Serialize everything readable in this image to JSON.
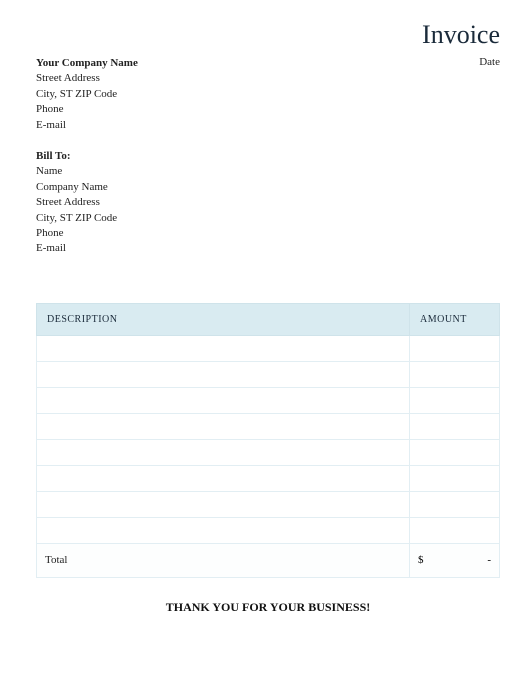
{
  "title": "Invoice",
  "date_label": "Date",
  "company": {
    "name": "Your Company Name",
    "street": "Street Address",
    "city_line": "City, ST  ZIP Code",
    "phone": "Phone",
    "email": "E-mail"
  },
  "bill_to": {
    "label": "Bill To:",
    "name": "Name",
    "company": "Company Name",
    "street": "Street Address",
    "city_line": "City, ST  ZIP Code",
    "phone": "Phone",
    "email": "E-mail"
  },
  "table": {
    "headers": {
      "description": "DESCRIPTION",
      "amount": "AMOUNT"
    },
    "rows": [
      {
        "description": "",
        "amount": ""
      },
      {
        "description": "",
        "amount": ""
      },
      {
        "description": "",
        "amount": ""
      },
      {
        "description": "",
        "amount": ""
      },
      {
        "description": "",
        "amount": ""
      },
      {
        "description": "",
        "amount": ""
      },
      {
        "description": "",
        "amount": ""
      },
      {
        "description": "",
        "amount": ""
      }
    ],
    "total_label": "Total",
    "total_currency": "$",
    "total_value": "-"
  },
  "footer_message": "THANK YOU FOR YOUR BUSINESS!"
}
